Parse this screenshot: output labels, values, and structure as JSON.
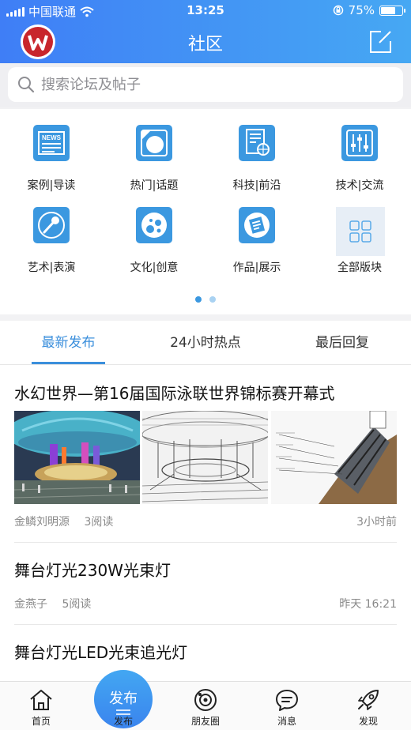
{
  "status_bar": {
    "carrier": "中国联通",
    "time": "13:25",
    "battery": "75%",
    "battery_level": 0.75
  },
  "header": {
    "title": "社区",
    "brand_color": "#3f7ef6"
  },
  "search": {
    "placeholder": "搜索论坛及帖子"
  },
  "categories": [
    {
      "label": "案例|导读",
      "icon": "news-icon"
    },
    {
      "label": "热门|话题",
      "icon": "hot-topic-icon"
    },
    {
      "label": "科技|前沿",
      "icon": "tech-icon"
    },
    {
      "label": "技术|交流",
      "icon": "mixer-icon"
    },
    {
      "label": "艺术|表演",
      "icon": "microphone-icon"
    },
    {
      "label": "文化|创意",
      "icon": "bubbles-icon"
    },
    {
      "label": "作品|展示",
      "icon": "document-icon"
    },
    {
      "label": "全部版块",
      "icon": "grid-icon"
    }
  ],
  "pager": {
    "pages": 2,
    "current": 1
  },
  "tabs": {
    "latest": "最新发布",
    "hot24": "24小时热点",
    "last_reply": "最后回复"
  },
  "posts": [
    {
      "title": "水幻世界—第16届国际泳联世界锦标赛开幕式",
      "author": "金鳞刘明源",
      "reads": "3阅读",
      "time": "3小时前"
    },
    {
      "title": "舞台灯光230W光束灯",
      "author": "金燕子",
      "reads": "5阅读",
      "time": "昨天 16:21"
    },
    {
      "title": "舞台灯光LED光束追光灯",
      "author": "",
      "reads": "",
      "time": ""
    }
  ],
  "tabbar": {
    "home": "首页",
    "publish": "发布",
    "friends": "朋友圈",
    "messages": "消息",
    "discover": "发现"
  },
  "colors": {
    "accent": "#3b8fdc",
    "icon_blue": "#3b98e0"
  }
}
